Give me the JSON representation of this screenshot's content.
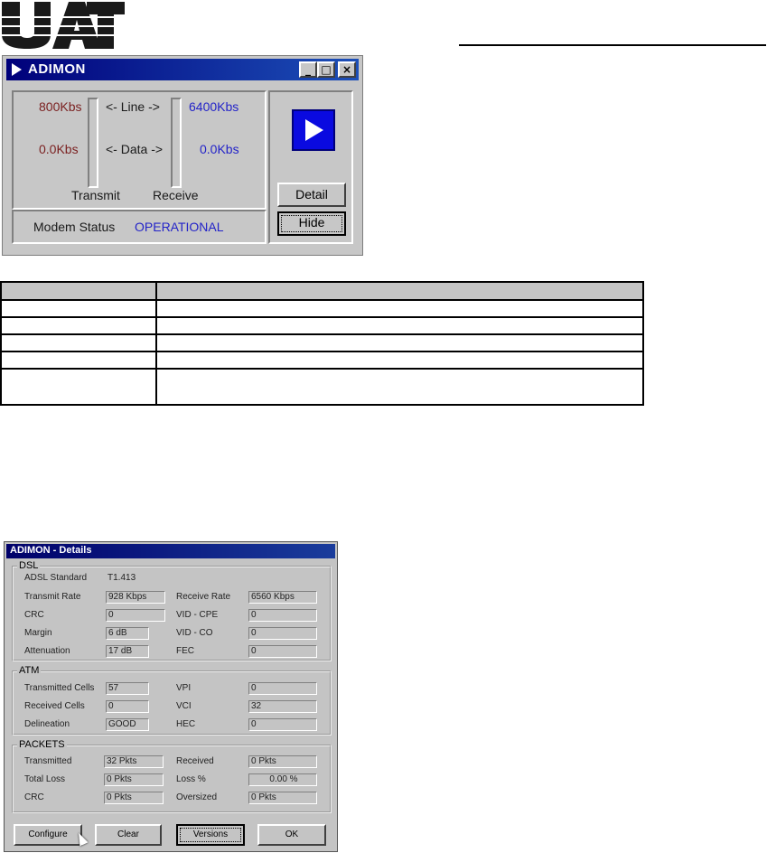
{
  "logo": {
    "text": "UAT",
    "color": "#1a1a1a"
  },
  "adimon": {
    "title": "ADIMON",
    "window_buttons": {
      "minimize": "_",
      "maximize": "□",
      "close": "×"
    },
    "line_label": "<- Line ->",
    "data_label": "<- Data ->",
    "transmit_line_rate": "800Kbs",
    "transmit_data_rate": "0.0Kbs",
    "receive_line_rate": "6400Kbs",
    "receive_data_rate": "0.0Kbs",
    "transmit_label": "Transmit",
    "receive_label": "Receive",
    "status_label": "Modem Status",
    "status_value": "OPERATIONAL",
    "detail_button": "Detail",
    "hide_button": "Hide"
  },
  "table": {
    "rows": [
      [
        "",
        ""
      ],
      [
        "",
        ""
      ],
      [
        "",
        ""
      ],
      [
        "",
        ""
      ],
      [
        "",
        ""
      ],
      [
        "",
        ""
      ]
    ]
  },
  "details": {
    "title": "ADIMON - Details",
    "dsl": {
      "group_label": "DSL",
      "adsl_standard_label": "ADSL Standard",
      "adsl_standard_value": "T1.413",
      "transmit_rate_label": "Transmit Rate",
      "transmit_rate_value": "928 Kbps",
      "receive_rate_label": "Receive Rate",
      "receive_rate_value": "6560 Kbps",
      "crc_label": "CRC",
      "crc_value": "0",
      "vid_cpe_label": "VID - CPE",
      "vid_cpe_value": "0",
      "margin_label": "Margin",
      "margin_value": "6 dB",
      "vid_co_label": "VID - CO",
      "vid_co_value": "0",
      "attenuation_label": "Attenuation",
      "attenuation_value": "17 dB",
      "fec_label": "FEC",
      "fec_value": "0"
    },
    "atm": {
      "group_label": "ATM",
      "transmitted_cells_label": "Transmitted Cells",
      "transmitted_cells_value": "57",
      "vpi_label": "VPI",
      "vpi_value": "0",
      "received_cells_label": "Received Cells",
      "received_cells_value": "0",
      "vci_label": "VCI",
      "vci_value": "32",
      "delineation_label": "Delineation",
      "delineation_value": "GOOD",
      "hec_label": "HEC",
      "hec_value": "0"
    },
    "packets": {
      "group_label": "PACKETS",
      "transmitted_label": "Transmitted",
      "transmitted_value": "32 Pkts",
      "received_label": "Received",
      "received_value": "0 Pkts",
      "total_loss_label": "Total Loss",
      "total_loss_value": "0 Pkts",
      "loss_pct_label": "Loss %",
      "loss_pct_value": "0.00 %",
      "crc_label": "CRC",
      "crc_value": "0 Pkts",
      "oversized_label": "Oversized",
      "oversized_value": "0 Pkts"
    },
    "buttons": {
      "configure": "Configure",
      "clear": "Clear",
      "versions": "Versions",
      "ok": "OK"
    }
  }
}
